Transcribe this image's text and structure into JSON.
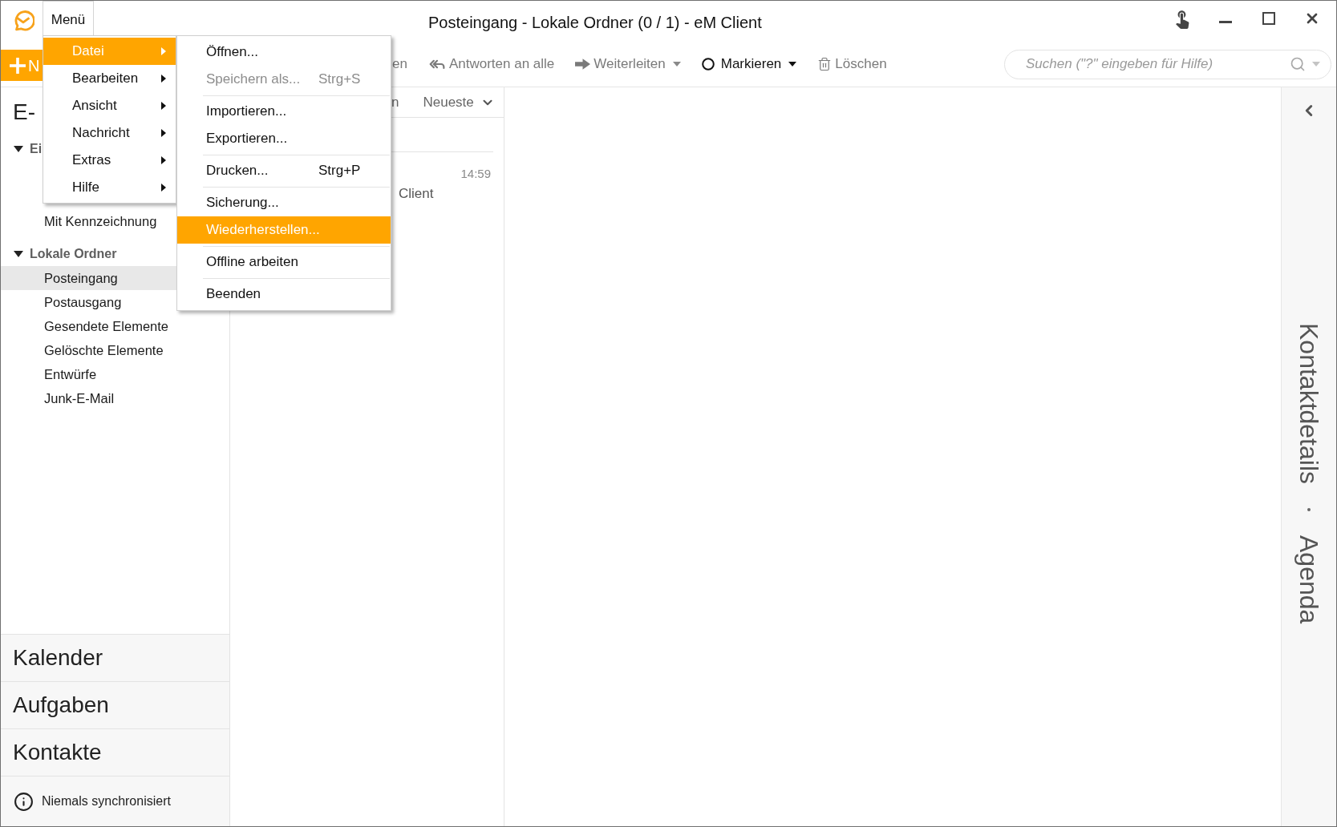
{
  "window": {
    "title": "Posteingang - Lokale Ordner (0 / 1) - eM Client"
  },
  "menu_button": {
    "label": "Menü",
    "expanded": true
  },
  "menu": {
    "items": [
      {
        "label": "Datei",
        "selected": true,
        "submenu": true
      },
      {
        "label": "Bearbeiten",
        "selected": false,
        "submenu": true
      },
      {
        "label": "Ansicht",
        "selected": false,
        "submenu": true
      },
      {
        "label": "Nachricht",
        "selected": false,
        "submenu": true
      },
      {
        "label": "Extras",
        "selected": false,
        "submenu": true
      },
      {
        "label": "Hilfe",
        "selected": false,
        "submenu": true
      }
    ]
  },
  "submenu": {
    "groups": [
      [
        {
          "label": "Öffnen...",
          "disabled": false,
          "selected": false
        },
        {
          "label": "Speichern als...",
          "shortcut": "Strg+S",
          "disabled": true,
          "selected": false
        }
      ],
      [
        {
          "label": "Importieren...",
          "disabled": false,
          "selected": false
        },
        {
          "label": "Exportieren...",
          "disabled": false,
          "selected": false
        }
      ],
      [
        {
          "label": "Drucken...",
          "shortcut": "Strg+P",
          "disabled": false,
          "selected": false
        }
      ],
      [
        {
          "label": "Sicherung...",
          "disabled": false,
          "selected": false
        },
        {
          "label": "Wiederherstellen...",
          "disabled": false,
          "selected": true
        }
      ],
      [
        {
          "label": "Offline arbeiten",
          "disabled": false,
          "selected": false
        }
      ],
      [
        {
          "label": "Beenden",
          "disabled": false,
          "selected": false
        }
      ]
    ]
  },
  "toolbar": {
    "new_button": {
      "label": "N"
    },
    "items": [
      {
        "kind": "text",
        "label": "en",
        "disabled": true,
        "dropdown": false
      },
      {
        "kind": "replyall",
        "label": "Antworten an alle",
        "disabled": true,
        "dropdown": false
      },
      {
        "kind": "forward",
        "label": "Weiterleiten",
        "disabled": true,
        "dropdown": true
      },
      {
        "kind": "mark",
        "label": "Markieren",
        "disabled": false,
        "dropdown": true
      },
      {
        "kind": "delete",
        "label": "Löschen",
        "disabled": true,
        "dropdown": false
      }
    ]
  },
  "search": {
    "placeholder": "Suchen (\"?\" eingeben für Hilfe)"
  },
  "sidebar": {
    "heading": "E-",
    "folders": [
      {
        "label": "Ei",
        "expanded": true,
        "children": [
          {
            "label": "Mit Kennzeichnung",
            "selected": false
          }
        ]
      },
      {
        "label": "Lokale Ordner",
        "expanded": true,
        "children": [
          {
            "label": "Posteingang",
            "selected": true
          },
          {
            "label": "Postausgang",
            "selected": false
          },
          {
            "label": "Gesendete Elemente",
            "selected": false
          },
          {
            "label": "Gelöschte Elemente",
            "selected": false
          },
          {
            "label": "Entwürfe",
            "selected": false
          },
          {
            "label": "Junk-E-Mail",
            "selected": false
          }
        ]
      }
    ],
    "modules": [
      {
        "label": "Kalender"
      },
      {
        "label": "Aufgaben"
      },
      {
        "label": "Kontakte"
      }
    ],
    "status": "Niemals synchronisiert"
  },
  "message_list": {
    "header": {
      "column_1": "n",
      "sort": "Neueste"
    },
    "messages": [
      {
        "time": "14:59",
        "preview": "Client"
      }
    ]
  },
  "side_panel": {
    "tabs": [
      {
        "label": "Kontaktdetails"
      },
      {
        "label": "Agenda"
      }
    ]
  }
}
